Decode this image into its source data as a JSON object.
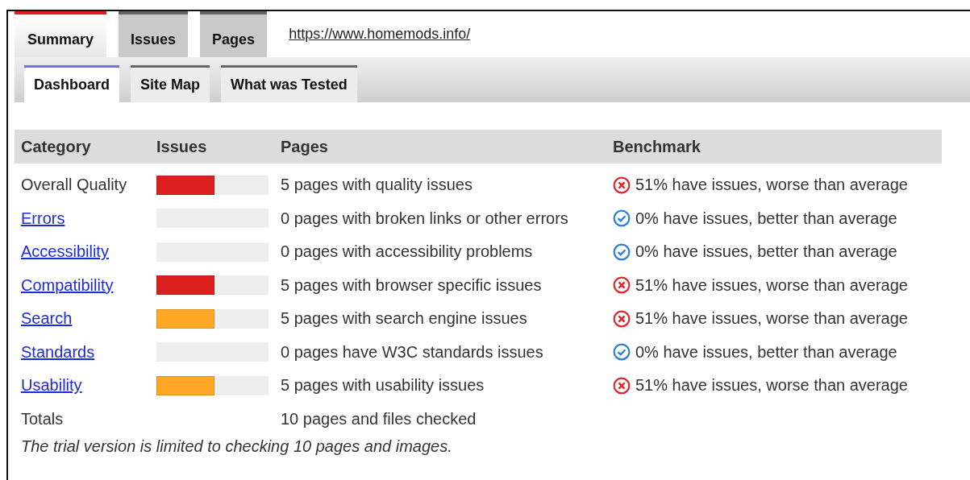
{
  "tabs": [
    {
      "label": "Summary",
      "selected": true
    },
    {
      "label": "Issues",
      "selected": false
    },
    {
      "label": "Pages",
      "selected": false
    }
  ],
  "url": "https://www.homemods.info/",
  "subtabs": [
    {
      "label": "Dashboard",
      "selected": true
    },
    {
      "label": "Site Map",
      "selected": false
    },
    {
      "label": "What was Tested",
      "selected": false
    }
  ],
  "table": {
    "columns": [
      "Category",
      "Issues",
      "Pages",
      "Benchmark"
    ],
    "rows": [
      {
        "category": "Overall Quality",
        "link": false,
        "level": 0.52,
        "color": "#dc2020",
        "pages": "5 pages with quality issues",
        "kind": "worse",
        "benchmark": "51% have issues, worse than average"
      },
      {
        "category": "Errors",
        "link": true,
        "pages": "0 pages with broken links or other errors",
        "kind": "better",
        "benchmark": "0% have issues, better than average"
      },
      {
        "category": "Accessibility",
        "link": true,
        "pages": "0 pages with accessibility problems",
        "kind": "better",
        "benchmark": "0% have issues, better than average"
      },
      {
        "category": "Compatibility",
        "link": true,
        "level": 0.52,
        "color": "#dc2020",
        "pages": "5 pages with browser specific issues",
        "kind": "worse",
        "benchmark": "51% have issues, worse than average"
      },
      {
        "category": "Search",
        "link": true,
        "level": 0.52,
        "color": "#ffa826",
        "pages": "5 pages with search engine issues",
        "kind": "worse",
        "benchmark": "51% have issues, worse than average"
      },
      {
        "category": "Standards",
        "link": true,
        "pages": "0 pages have W3C standards issues",
        "kind": "better",
        "benchmark": "0% have issues, better than average"
      },
      {
        "category": "Usability",
        "link": true,
        "level": 0.52,
        "color": "#ffa826",
        "pages": "5 pages with usability issues",
        "kind": "worse",
        "benchmark": "51% have issues, worse than average"
      }
    ],
    "totals": {
      "label": "Totals",
      "pages": "10 pages and files checked"
    }
  },
  "note": "The trial version is limited to checking 10 pages and images."
}
